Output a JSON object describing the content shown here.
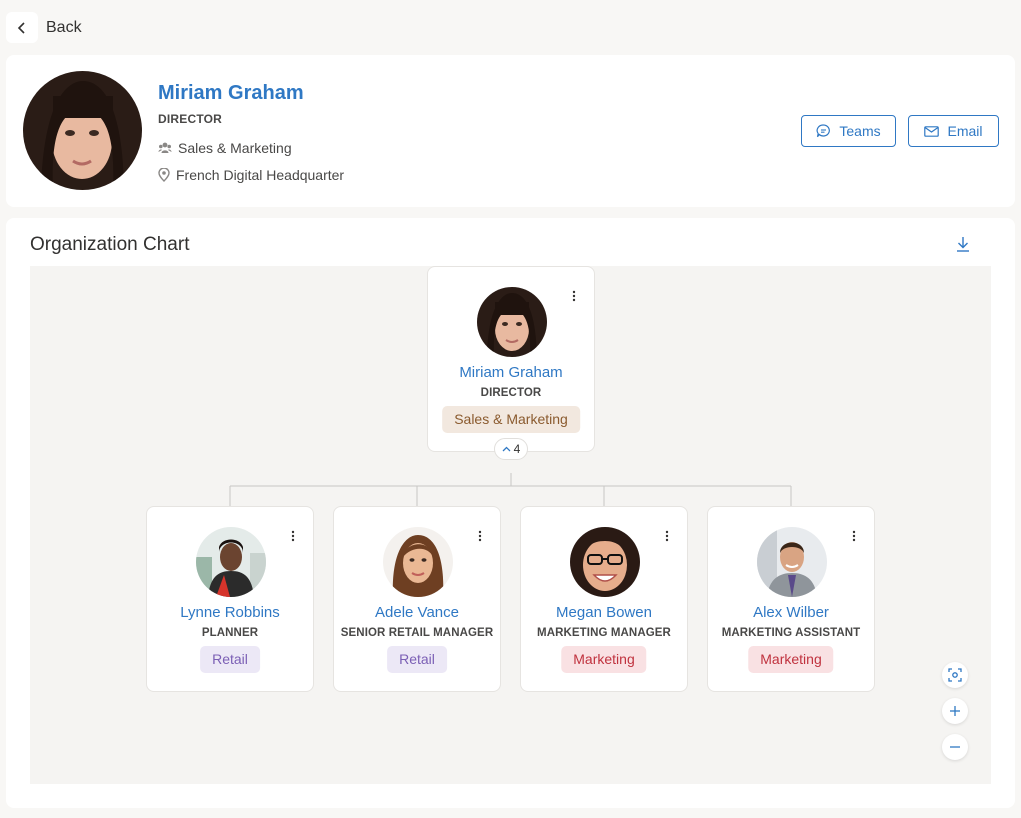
{
  "nav": {
    "back_label": "Back"
  },
  "profile": {
    "name": "Miriam Graham",
    "title": "DIRECTOR",
    "department": "Sales & Marketing",
    "location": "French Digital Headquarter",
    "actions": {
      "teams_label": "Teams",
      "email_label": "Email"
    }
  },
  "org_chart": {
    "title": "Organization Chart",
    "root": {
      "name": "Miriam Graham",
      "title": "DIRECTOR",
      "tag": "Sales & Marketing",
      "tag_color": "#f2e8df",
      "tag_text_color": "#8a5a2e",
      "report_count": "4"
    },
    "reports": [
      {
        "name": "Lynne Robbins",
        "title": "PLANNER",
        "tag": "Retail",
        "tag_color": "#ece8f6",
        "tag_text_color": "#7b5fb5"
      },
      {
        "name": "Adele Vance",
        "title": "SENIOR RETAIL MANAGER",
        "tag": "Retail",
        "tag_color": "#ece8f6",
        "tag_text_color": "#7b5fb5"
      },
      {
        "name": "Megan Bowen",
        "title": "MARKETING MANAGER",
        "tag": "Marketing",
        "tag_color": "#f9e1e3",
        "tag_text_color": "#c0323e"
      },
      {
        "name": "Alex Wilber",
        "title": "MARKETING ASSISTANT",
        "tag": "Marketing",
        "tag_color": "#f9e1e3",
        "tag_text_color": "#c0323e"
      }
    ]
  },
  "colors": {
    "accent": "#2f78c4",
    "page_bg": "#f8f7f5",
    "canvas_bg": "#f5f4f2"
  },
  "icons": {
    "back": "chevron-left-icon",
    "department": "people-group-icon",
    "location": "map-pin-icon",
    "teams": "chat-bubble-icon",
    "email": "envelope-icon",
    "download": "download-icon",
    "kebab": "more-vertical-icon",
    "expand": "chevron-up-icon",
    "fit": "fit-to-screen-icon",
    "zoom_in": "plus-icon",
    "zoom_out": "minus-icon"
  }
}
